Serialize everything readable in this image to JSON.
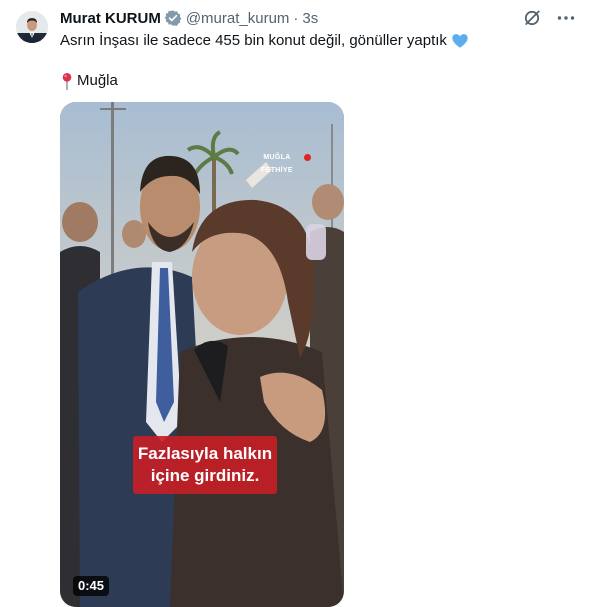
{
  "author": {
    "display_name": "Murat KURUM",
    "handle": "@murat_kurum",
    "separator": "·",
    "time": "3s",
    "verified": true
  },
  "tweet": {
    "text": "Asrın İnşası ile sadece 455 bin konut değil, gönüller yaptık",
    "emoji": "blue-heart-icon",
    "location_emoji": "round-pushpin-icon",
    "location": "Muğla"
  },
  "media": {
    "overlay_location": "MUĞLA",
    "overlay_sublocation": "FETHİYE",
    "caption_line1": "Fazlasıyla halkın",
    "caption_line2": "içine girdiniz.",
    "duration": "0:45"
  },
  "icons": {
    "header_actions": [
      "grok-icon",
      "more-icon"
    ]
  },
  "colors": {
    "text_primary": "#0f1419",
    "text_secondary": "#536471",
    "verified": "#829aab",
    "heart": "#5dadec",
    "caption_bg": "#c42026"
  }
}
